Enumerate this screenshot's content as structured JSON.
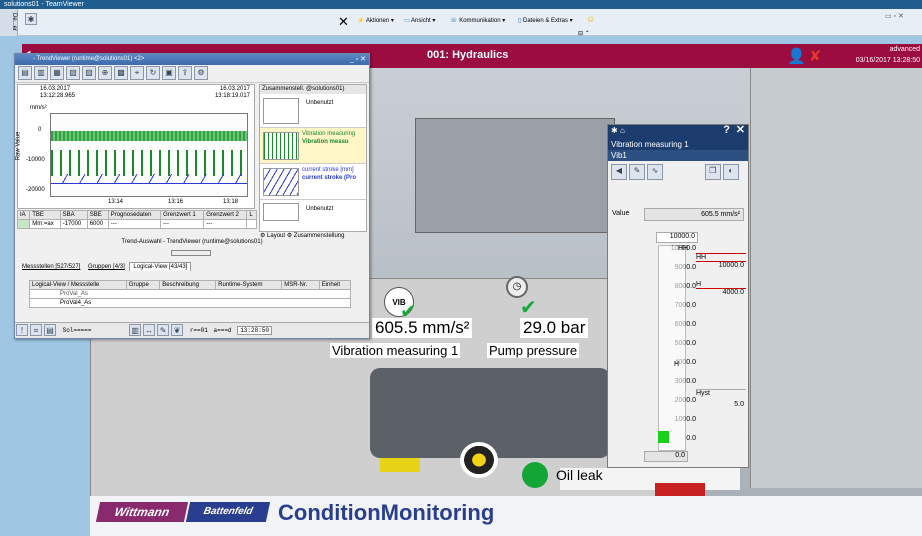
{
  "teamviewer": {
    "title": "solutions01 - TeamViewer",
    "side_label": "De...er",
    "toolbar": {
      "actions": "Aktionen",
      "view": "Ansicht",
      "communication": "Kommunikation",
      "files": "Dateien & Extras"
    }
  },
  "scada": {
    "title": "001: Hydraulics",
    "user_level": "advanced",
    "datetime": "03/16/2017 13:28:50"
  },
  "trendviewer": {
    "title": "- TrendViewer (runtime@solutions01) <2>",
    "start_date": "16.03.2017",
    "start_time": "13:12:28.965",
    "end_date": "16.03.2017",
    "end_time": "13:18:19.017",
    "unit": "mm/s²",
    "y_label": "Raw Value",
    "y_ticks": [
      "0",
      "-10000",
      "-20000"
    ],
    "x_ticks": [
      "13:14",
      "13:16",
      "13:18"
    ],
    "summary_title": "Zusammenstell. @solutions01)",
    "summary_items": [
      {
        "l1": "Unbenutzt",
        "l2": ""
      },
      {
        "l1": "Vibration measuring",
        "l2": "Vibration measu"
      },
      {
        "l1": "current stroke [mm]",
        "l2": "current stroke (Pro"
      },
      {
        "l1": "Unbenutzt",
        "l2": ""
      }
    ],
    "layout_label": "Layout",
    "summary_tab": "Zusammenstellung",
    "table_headers": [
      "IA",
      "TBE",
      "SBA",
      "SBE",
      "Prognosedaten",
      "Grenzwert 1",
      "Grenzwert 2",
      "L"
    ],
    "table_row": [
      "",
      "Mm:=ax",
      "-17000",
      "6000",
      "---",
      "---",
      "---",
      ""
    ],
    "lower_title": "Trend-Auswahl - TrendViewer (runtime@solutions01)",
    "lower_tabs": [
      "Messstellen [527/527]",
      "Gruppen [4/3]",
      "Logical-View [43/43]"
    ],
    "lower_headers": [
      "Logical-View / Messstelle",
      "Gruppe",
      "Beschreibung",
      "Runtime-System",
      "MSR-Nr.",
      "Einheit"
    ],
    "lower_rows": [
      "ProVal_As",
      "ProVal4_As"
    ],
    "status_left": "Sol=====",
    "status_mid": "r==01",
    "status_right": "a===d",
    "status_time": "13:28:50"
  },
  "scene": {
    "vib_value": "605.5 mm/s²",
    "vib_label": "Vibration measuring 1",
    "vib_icon": "VIB",
    "pump_value": "29.0 bar",
    "pump_label": "Pump pressure",
    "oil_label": "Oil leak"
  },
  "vib_panel": {
    "title": "Vibration measuring 1",
    "tag": "Vib1",
    "value_label": "Value",
    "value": "605.5 mm/s²",
    "scale_max": "10000.0",
    "scale": [
      "10000.0",
      "9000.0",
      "8000.0",
      "7000.0",
      "6000.0",
      "5000.0",
      "4000.0",
      "3000.0",
      "2000.0",
      "1000.0",
      "0.0"
    ],
    "hh_marker": "HH",
    "h_marker": "H",
    "bottom_value": "0.0",
    "hh_label": "HH",
    "hh_value": "10000.0",
    "h_label": "H",
    "h_value": "4000.0",
    "hyst_label": "Hyst",
    "hyst_value": "5.0"
  },
  "brand": {
    "wittmann": "Wittmann",
    "battenfeld": "Battenfeld",
    "cm": "ConditionMonitoring"
  },
  "colors": {
    "scada_bar": "#9b0d3f",
    "brand_blue": "#2a3e8f",
    "ok_green": "#13a536",
    "panel_header": "#1c3c6e"
  }
}
